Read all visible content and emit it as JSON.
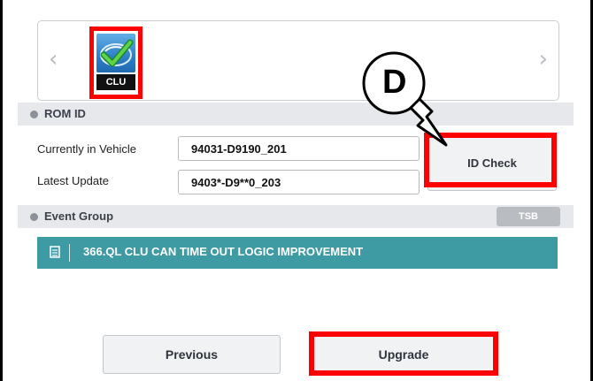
{
  "module": {
    "icon_label": "CLU",
    "nav_prev_glyph": "‹",
    "nav_next_glyph": "›"
  },
  "rom_id": {
    "section_title": "ROM ID",
    "current_label": "Currently in Vehicle",
    "current_value": "94031-D9190_201",
    "latest_label": "Latest Update",
    "latest_value": "9403*-D9**0_203",
    "id_check_label": "ID Check"
  },
  "event_group": {
    "section_title": "Event Group",
    "tsb_label": "TSB",
    "events": [
      {
        "text": "366.QL CLU CAN TIME OUT LOGIC IMPROVEMENT"
      }
    ]
  },
  "actions": {
    "previous_label": "Previous",
    "upgrade_label": "Upgrade"
  },
  "callout": {
    "letter": "D"
  },
  "colors": {
    "highlight": "#ff0000",
    "event_row": "#3e9aa3",
    "section_bar": "#e6e8ec"
  }
}
